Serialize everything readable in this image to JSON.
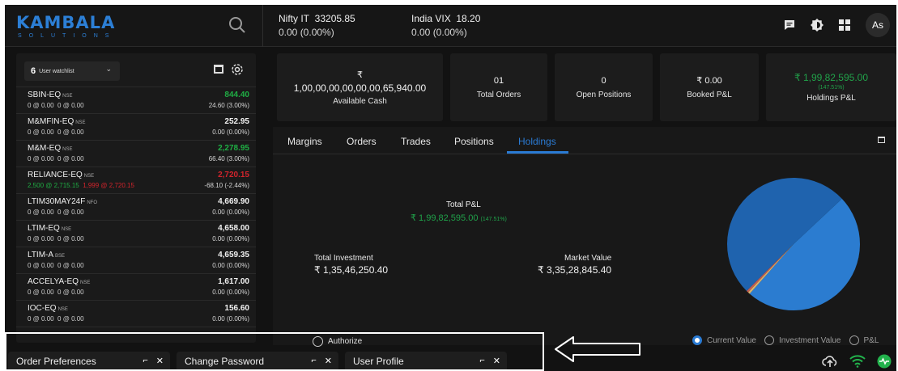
{
  "brand": {
    "logo_main": "KAMBALA",
    "logo_sub": "SOLUTIONS"
  },
  "header": {
    "indices": [
      {
        "name": "Nifty IT",
        "value": "33205.85",
        "change": "0.00 (0.00%)"
      },
      {
        "name": "India VIX",
        "value": "18.20",
        "change": "0.00 (0.00%)"
      }
    ],
    "icons": [
      "search-icon",
      "chat-icon",
      "theme-icon",
      "apps-grid-icon"
    ],
    "avatar": "As"
  },
  "watchlist": {
    "number": "6",
    "name": "User watchlist",
    "items": [
      {
        "symbol": "SBIN-EQ",
        "exchange": "NSE",
        "bid": "0 @ 0.00",
        "ask": "0 @ 0.00",
        "ltp": "844.40",
        "change": "24.60 (3.00%)",
        "trend": "up"
      },
      {
        "symbol": "M&MFIN-EQ",
        "exchange": "NSE",
        "bid": "0 @ 0.00",
        "ask": "0 @ 0.00",
        "ltp": "252.95",
        "change": "0.00 (0.00%)",
        "trend": "flat"
      },
      {
        "symbol": "M&M-EQ",
        "exchange": "NSE",
        "bid": "0 @ 0.00",
        "ask": "0 @ 0.00",
        "ltp": "2,278.95",
        "change": "66.40 (3.00%)",
        "trend": "up"
      },
      {
        "symbol": "RELIANCE-EQ",
        "exchange": "NSE",
        "bid": "2,500 @ 2,715.15",
        "ask": "1,999 @ 2,720.15",
        "ltp": "2,720.15",
        "change": "-68.10 (-2.44%)",
        "trend": "down"
      },
      {
        "symbol": "LTIM30MAY24F",
        "exchange": "NFO",
        "bid": "0 @ 0.00",
        "ask": "0 @ 0.00",
        "ltp": "4,669.90",
        "change": "0.00 (0.00%)",
        "trend": "flat"
      },
      {
        "symbol": "LTIM-EQ",
        "exchange": "NSE",
        "bid": "0 @ 0.00",
        "ask": "0 @ 0.00",
        "ltp": "4,658.00",
        "change": "0.00 (0.00%)",
        "trend": "flat"
      },
      {
        "symbol": "LTIM-A",
        "exchange": "BSE",
        "bid": "0 @ 0.00",
        "ask": "0 @ 0.00",
        "ltp": "4,659.35",
        "change": "0.00 (0.00%)",
        "trend": "flat"
      },
      {
        "symbol": "ACCELYA-EQ",
        "exchange": "NSE",
        "bid": "0 @ 0.00",
        "ask": "0 @ 0.00",
        "ltp": "1,617.00",
        "change": "0.00 (0.00%)",
        "trend": "flat"
      },
      {
        "symbol": "IOC-EQ",
        "exchange": "NSE",
        "bid": "0 @ 0.00",
        "ask": "0 @ 0.00",
        "ltp": "156.60",
        "change": "0.00 (0.00%)",
        "trend": "flat"
      }
    ]
  },
  "stats": {
    "cash": {
      "symbol": "₹",
      "value": "1,00,00,00,00,00,00,65,940.00",
      "label": "Available Cash"
    },
    "orders": {
      "value": "01",
      "label": "Total Orders"
    },
    "positions": {
      "value": "0",
      "label": "Open Positions"
    },
    "booked": {
      "value": "₹ 0.00",
      "label": "Booked P&L"
    },
    "holdings": {
      "value": "₹ 1,99,82,595.00",
      "pct": "(147.51%)",
      "label": "Holdings P&L"
    }
  },
  "tabs": [
    "Margins",
    "Orders",
    "Trades",
    "Positions",
    "Holdings"
  ],
  "active_tab": "Holdings",
  "holdings": {
    "pl_title": "Total P&L",
    "pl_value": "₹ 1,99,82,595.00",
    "pl_pct": "(147.51%)",
    "investment_label": "Total Investment",
    "investment_value": "₹ 1,35,46,250.40",
    "market_label": "Market Value",
    "market_value": "₹ 3,35,28,845.40",
    "view_options": [
      "Current Value",
      "Investment Value",
      "P&L"
    ],
    "selected_view": "Current Value"
  },
  "chart_data": {
    "type": "pie",
    "slices": [
      {
        "share": 0.485,
        "color": "#2b7cd0"
      },
      {
        "share": 0.005,
        "color": "#d8b46a"
      },
      {
        "share": 0.005,
        "color": "#c25c4f"
      },
      {
        "share": 0.505,
        "color": "#1f63ae"
      }
    ]
  },
  "footer": {
    "authorize": "Authorize",
    "windows": [
      {
        "title": "Order Preferences"
      },
      {
        "title": "Change Password"
      },
      {
        "title": "User Profile"
      }
    ],
    "status_icons": [
      "cloud-upload-icon",
      "wifi-icon",
      "heartbeat-icon"
    ]
  },
  "colors": {
    "accent": "#2a7bd4",
    "up": "#1fae44",
    "down": "#d3242c",
    "bg": "#121212"
  }
}
